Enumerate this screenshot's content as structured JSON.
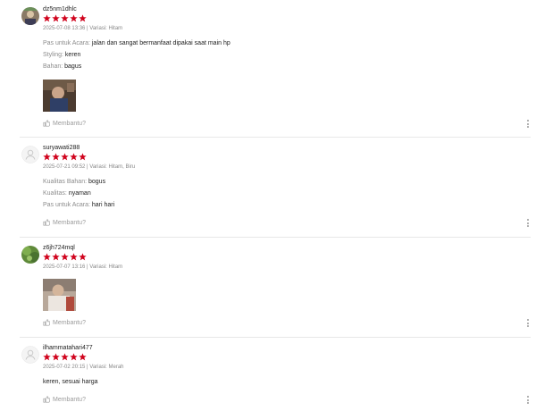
{
  "colors": {
    "star": "#d0011b",
    "text": "#222222",
    "meta": "#888888",
    "label": "#8c8c8c",
    "helpful": "#9b9b9b",
    "divider": "#e8e8e8"
  },
  "helpful_label": "Membantu?",
  "reviews": [
    {
      "username": "dz5nm1dhlc",
      "rating": 5,
      "meta": "2025-07-08 13:36 | Variasi: Hitam",
      "avatar": "user-photo-avatar",
      "attributes": [
        {
          "key": "Pas untuk Acara:",
          "value": "jalan dan sangat bermanfaat dipakai saat main hp"
        },
        {
          "key": "Styling:",
          "value": "keren"
        },
        {
          "key": "Bahan:",
          "value": "bagus"
        }
      ],
      "has_photo": true
    },
    {
      "username": "suryawati288",
      "rating": 5,
      "meta": "2025-07-21 09:52 | Variasi: Hitam, Biru",
      "avatar": "default-user-icon",
      "attributes": [
        {
          "key": "Kualitas Bahan:",
          "value": "bogus"
        },
        {
          "key": "Kualitas:",
          "value": "nyaman"
        },
        {
          "key": "Pas untuk Acara:",
          "value": "hari hari"
        }
      ],
      "has_photo": false
    },
    {
      "username": "z6jh724mql",
      "rating": 5,
      "meta": "2025-07-07 13:16 | Variasi: Hitam",
      "avatar": "green-photo-avatar",
      "attributes": [],
      "has_photo": true
    },
    {
      "username": "ilhammatahari477",
      "rating": 5,
      "meta": "2025-07-02 20:15 | Variasi: Merah",
      "avatar": "default-user-icon",
      "comment": "keren, sesuai harga",
      "attributes": [],
      "has_photo": false
    }
  ]
}
